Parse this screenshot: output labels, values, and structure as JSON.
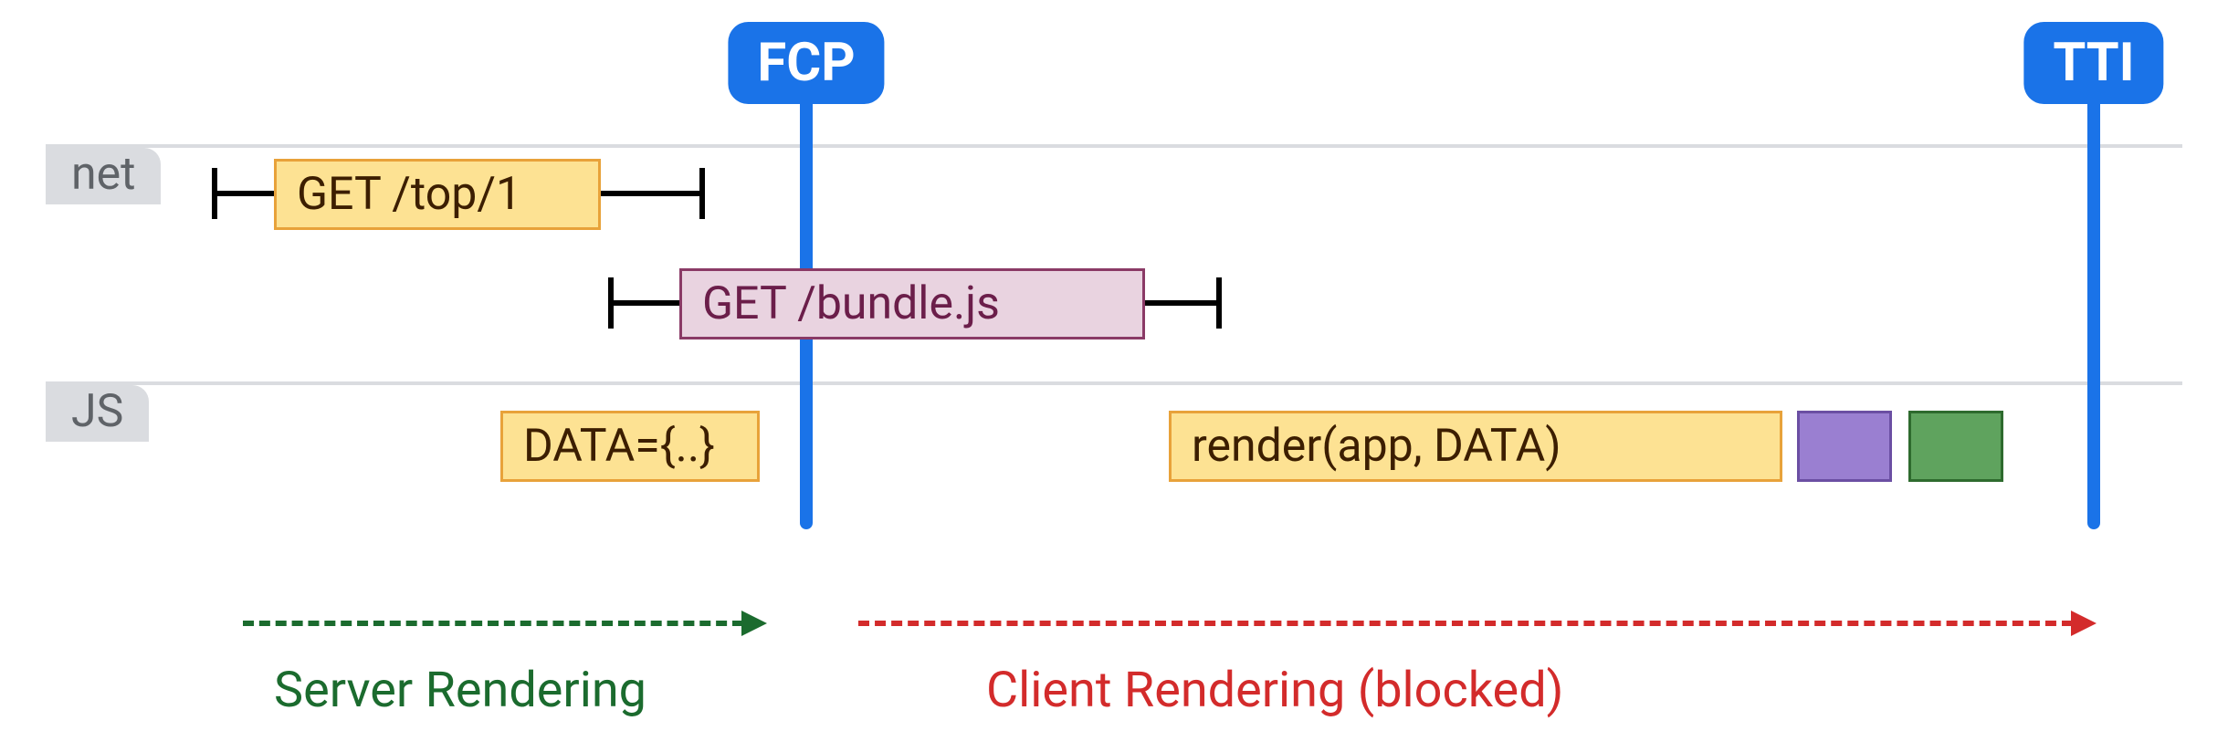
{
  "lanes": {
    "net": {
      "label": "net"
    },
    "js": {
      "label": "JS"
    }
  },
  "markers": {
    "fcp": {
      "label": "FCP"
    },
    "tti": {
      "label": "TTI"
    }
  },
  "net": {
    "req1": {
      "label": "GET /top/1"
    },
    "req2": {
      "label": "GET /bundle.js"
    }
  },
  "js": {
    "data": {
      "label": "DATA={..}"
    },
    "render": {
      "label": "render(app, DATA)"
    }
  },
  "phases": {
    "server": {
      "label": "Server Rendering"
    },
    "client": {
      "label": "Client Rendering (blocked)"
    }
  },
  "colors": {
    "blue": "#1a73e8",
    "yellow": "#fde293",
    "pink": "#e9d3e0",
    "purple": "#9a7fd1",
    "green": "#5fa35e",
    "serverGreen": "#1b6b2e",
    "clientRed": "#d32b2b"
  }
}
